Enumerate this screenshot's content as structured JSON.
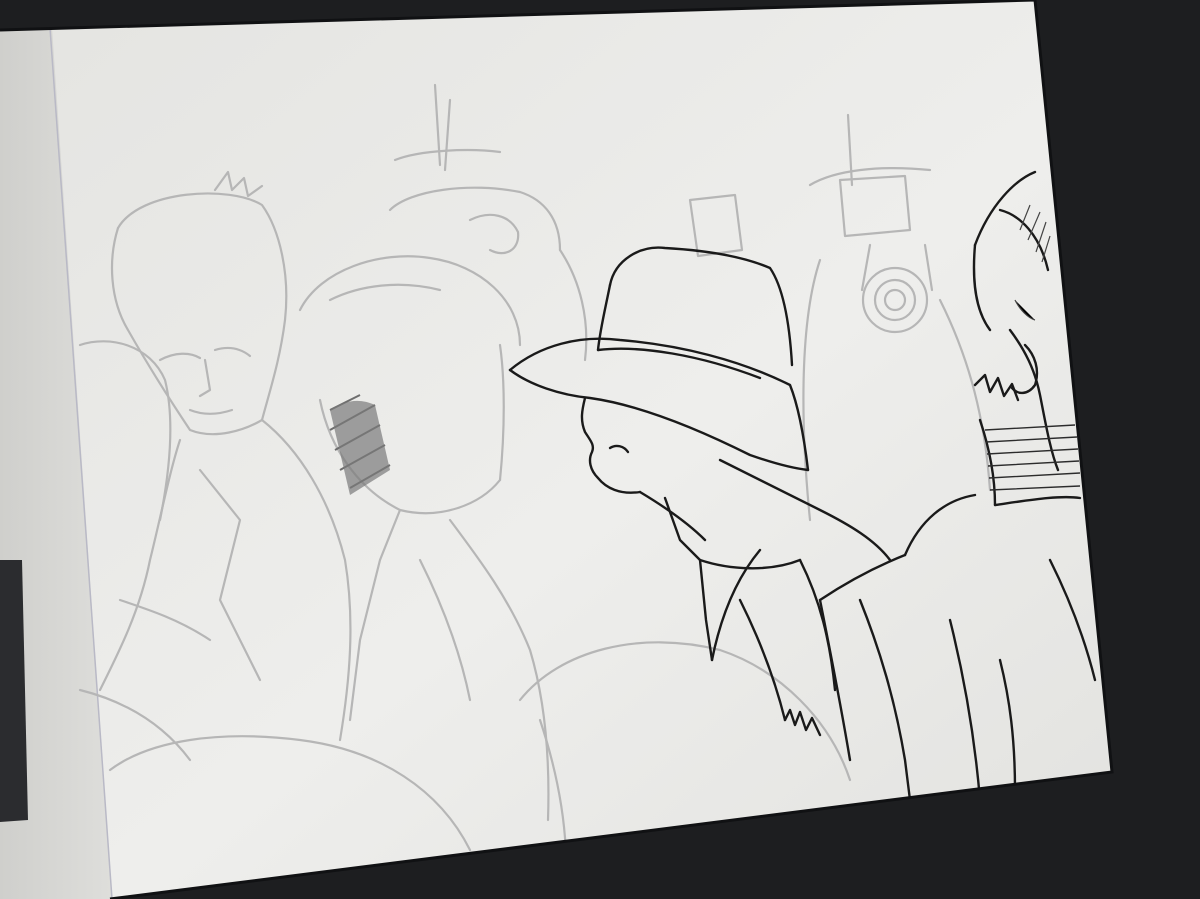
{
  "photo": {
    "subject": "",
    "colors": {
      "bezel": "#1d1e20",
      "screen": "#ededeb",
      "screen_shadow": "#d9d9d6",
      "sketch_gray": "#b3b3b3",
      "ink": "#1a1a1a",
      "hatch": "#3a3a3a"
    }
  }
}
